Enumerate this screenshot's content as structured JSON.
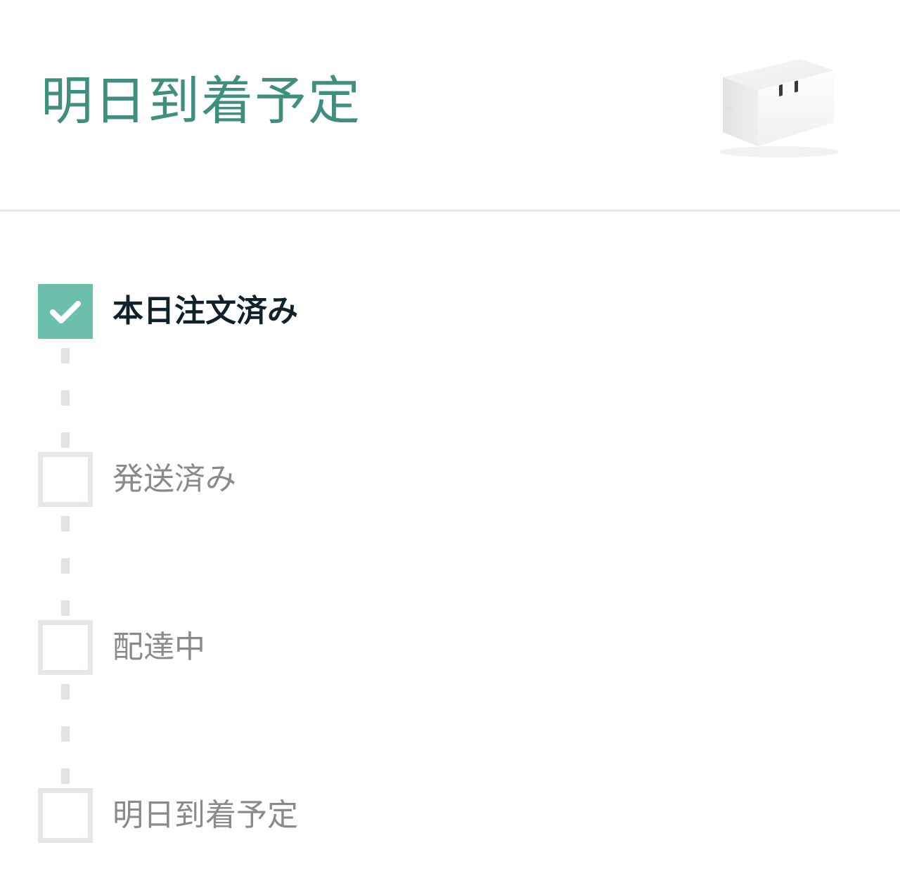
{
  "header": {
    "title": "明日到着予定",
    "title_color": "#3f8f7f",
    "product_image": "smart-plug-product-image"
  },
  "tracker": {
    "active_color": "#6bbfac",
    "inactive_color": "#e8e6e6",
    "steps": [
      {
        "label": "本日注文済み",
        "completed": true,
        "icon": "checkmark-icon"
      },
      {
        "label": "発送済み",
        "completed": false
      },
      {
        "label": "配達中",
        "completed": false
      },
      {
        "label": "明日到着予定",
        "completed": false
      }
    ]
  }
}
